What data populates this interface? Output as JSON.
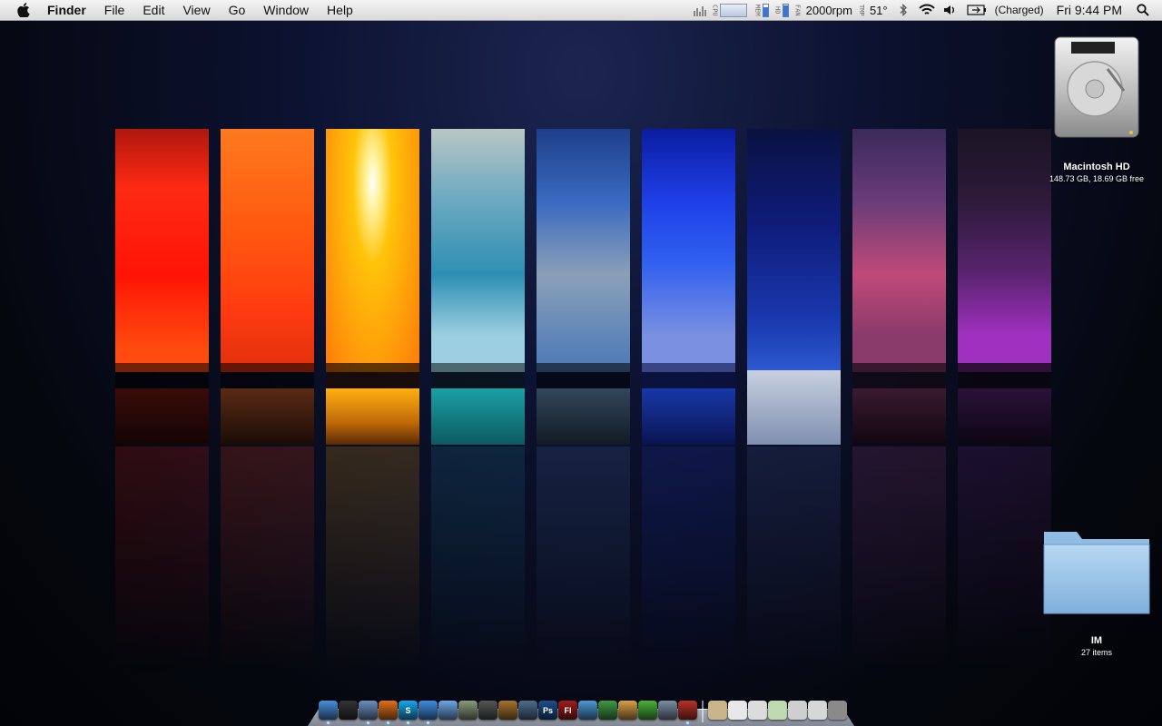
{
  "menubar": {
    "app_name": "Finder",
    "menus": [
      "File",
      "Edit",
      "View",
      "Go",
      "Window",
      "Help"
    ],
    "status": {
      "cpu_tag": "CPU",
      "mem_tag": "MEM",
      "hd_tag": "HD",
      "fan_tag": "FAN",
      "fan_speed": "2000rpm",
      "tmp_tag": "TMP",
      "temperature": "51°",
      "battery": "(Charged)",
      "clock": "Fri 9:44 PM"
    }
  },
  "desktop_icons": {
    "hard_drive": {
      "name": "Macintosh HD",
      "info": "148.73 GB, 18.69 GB free"
    },
    "folder": {
      "name": "IM",
      "info": "27 items"
    }
  },
  "dock": {
    "apps": [
      {
        "name": "finder-icon",
        "label": "",
        "color": "#4a8fdc",
        "running": true
      },
      {
        "name": "dashboard-icon",
        "label": "",
        "color": "#333333",
        "running": false
      },
      {
        "name": "mail-icon",
        "label": "",
        "color": "#6c8fbf",
        "running": true
      },
      {
        "name": "firefox-icon",
        "label": "",
        "color": "#e0701a",
        "running": true
      },
      {
        "name": "skype-icon",
        "label": "S",
        "color": "#1aa8ec",
        "running": true
      },
      {
        "name": "ichat-icon",
        "label": "",
        "color": "#3f8de0",
        "running": true
      },
      {
        "name": "itunes-icon",
        "label": "",
        "color": "#6ea8e8",
        "running": false
      },
      {
        "name": "iphoto-icon",
        "label": "",
        "color": "#8a9c7c",
        "running": false
      },
      {
        "name": "imovie-icon",
        "label": "",
        "color": "#555555",
        "running": false
      },
      {
        "name": "garageband-icon",
        "label": "",
        "color": "#a8742c",
        "running": false
      },
      {
        "name": "spaces-icon",
        "label": "",
        "color": "#4f6d8e",
        "running": false
      },
      {
        "name": "photoshop-icon",
        "label": "Ps",
        "color": "#1d4f8f",
        "running": false
      },
      {
        "name": "flash-icon",
        "label": "Fl",
        "color": "#a01c1c",
        "running": false
      },
      {
        "name": "iwork-icon",
        "label": "",
        "color": "#4c9ad6",
        "running": false
      },
      {
        "name": "cactus-icon",
        "label": "",
        "color": "#3e9b45",
        "running": false
      },
      {
        "name": "cyberduck-icon",
        "label": "",
        "color": "#d8a04a",
        "running": false
      },
      {
        "name": "leaf-icon",
        "label": "",
        "color": "#4ab33a",
        "running": false
      },
      {
        "name": "xcode-icon",
        "label": "",
        "color": "#7b8fa6",
        "running": false
      },
      {
        "name": "filezilla-icon",
        "label": "",
        "color": "#b7332b",
        "running": true
      }
    ],
    "docs": [
      {
        "name": "applications-stack-icon",
        "color": "#c9b48c"
      },
      {
        "name": "pdf-doc-icon",
        "color": "#e8e8e8"
      },
      {
        "name": "text-doc-icon",
        "color": "#dcdcdc"
      },
      {
        "name": "downloads-stack-icon",
        "color": "#bfd8b0"
      },
      {
        "name": "document-stack-icon",
        "color": "#cfcfcf"
      },
      {
        "name": "mail-stack-icon",
        "color": "#d7d7d7"
      },
      {
        "name": "trash-icon",
        "color": "#8a8a8a"
      }
    ]
  },
  "colors": {
    "strip_red": "#ff1a0a",
    "strip_orange": "#ff5a10",
    "strip_yellow": "#ffc40a",
    "strip_teal": "#3aa6c0",
    "strip_sky_blue": "#2a56a8",
    "strip_blue": "#1630d8",
    "strip_navy": "#0e1c7a",
    "strip_magenta": "#a14e86",
    "strip_purple": "#5a2470"
  }
}
